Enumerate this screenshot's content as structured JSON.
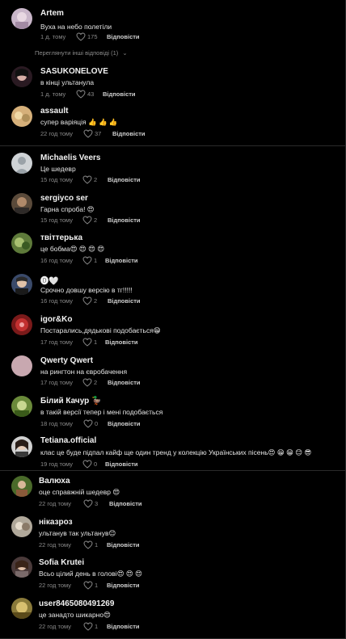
{
  "comments": [
    {
      "username": "Artem",
      "text": "Вуха на небо полетіли",
      "time": "1 д. тому",
      "likes": "175",
      "reply": "Відповісти"
    },
    {
      "username": "SASUKONELOVE",
      "text": "в кінці ультанула",
      "time": "1 д. тому",
      "likes": "43",
      "reply": "Відповісти"
    },
    {
      "username": "assault",
      "text": "супер варіяція 👍 👍 👍",
      "time": "22 год тому",
      "likes": "37",
      "reply": "Відповісти"
    },
    {
      "username": "Michaelis Veers",
      "text": "Це шедевр",
      "time": "15 год тому",
      "likes": "2",
      "reply": "Відповісти"
    },
    {
      "username": "sergiyco ser",
      "text": "Гарна спроба! 😍",
      "time": "15 год тому",
      "likes": "2",
      "reply": "Відповісти"
    },
    {
      "username": "твіттерька",
      "text": "це бобма😍 😍 😍 😍",
      "time": "16 год тому",
      "likes": "1",
      "reply": "Відповісти"
    },
    {
      "username": "🅓🤍",
      "text": "Срочно довшу версію в тг!!!!!",
      "time": "16 год тому",
      "likes": "2",
      "reply": "Відповісти"
    },
    {
      "username": "igor&Ko",
      "text": "Постарались,дядькові подобається😁",
      "time": "17 год тому",
      "likes": "1",
      "reply": "Відповісти"
    },
    {
      "username": "Qwerty Qwert",
      "text": "на рингтон на євробачення",
      "time": "17 год тому",
      "likes": "2",
      "reply": "Відповісти"
    },
    {
      "username": "Білий Качур 🦆",
      "text": "в такій версії тепер і мені подобається",
      "time": "18 год тому",
      "likes": "0",
      "reply": "Відповісти"
    },
    {
      "username": "Tetiana.official",
      "text": "клас це буде підпал кайф ще один тренд у колекцію Українських пісень😍 😁 😁 😊 😎",
      "time": "19 год тому",
      "likes": "0",
      "reply": "Відповісти"
    },
    {
      "username": "Валюха",
      "text": "оце справжній шедевр 😍",
      "time": "22 год тому",
      "likes": "3",
      "reply": "Відповісти"
    },
    {
      "username": "ніказроз",
      "text": "ультанув так ультанув😊",
      "time": "22 год тому",
      "likes": "1",
      "reply": "Відповісти"
    },
    {
      "username": "Sofia Krutei",
      "text": "Всьо цілий день в голові😍 😍 😍",
      "time": "22 год тому",
      "likes": "1",
      "reply": "Відповісти"
    },
    {
      "username": "user8465080491269",
      "text": "це занадто шикарно😍",
      "time": "22 год тому",
      "likes": "1",
      "reply": "Відповісти"
    }
  ],
  "more_replies": "Переглянути інші відповіді (1)",
  "colors": {
    "background": "#000000",
    "text": "#f2f2f2",
    "meta": "#8a8a8a",
    "separator": "#2a2a2a"
  }
}
